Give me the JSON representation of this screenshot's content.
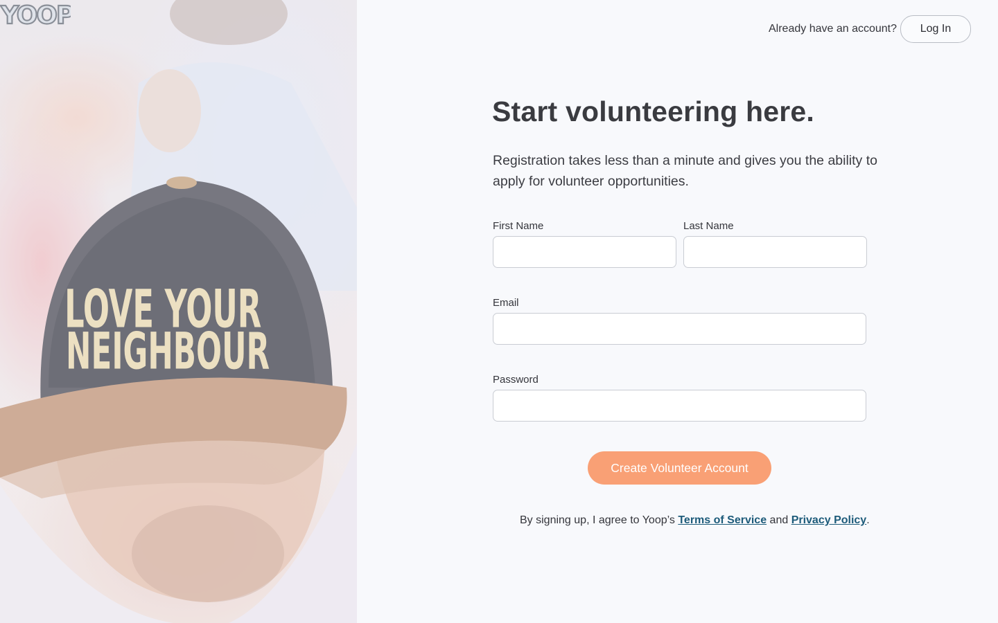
{
  "brand": {
    "logo_text": "YOOP"
  },
  "hero": {
    "cap_line1": "LOVE YOUR",
    "cap_line2": "NEIGHBOUR"
  },
  "header": {
    "prompt": "Already have an account?",
    "login_label": "Log In"
  },
  "main": {
    "title": "Start volunteering here.",
    "subtitle": "Registration takes less than a minute and gives you the ability to apply for volunteer opportunities."
  },
  "form": {
    "first_name_label": "First Name",
    "first_name_value": "",
    "last_name_label": "Last Name",
    "last_name_value": "",
    "email_label": "Email",
    "email_value": "",
    "password_label": "Password",
    "password_value": "",
    "submit_label": "Create Volunteer Account"
  },
  "legal": {
    "prefix": "By signing up, I agree to Yoop’s ",
    "terms_label": "Terms of Service",
    "middle": " and ",
    "privacy_label": "Privacy Policy",
    "suffix": "."
  },
  "colors": {
    "accent": "#f9a075",
    "link": "#1d5b7a",
    "background": "#f8f9fc"
  }
}
